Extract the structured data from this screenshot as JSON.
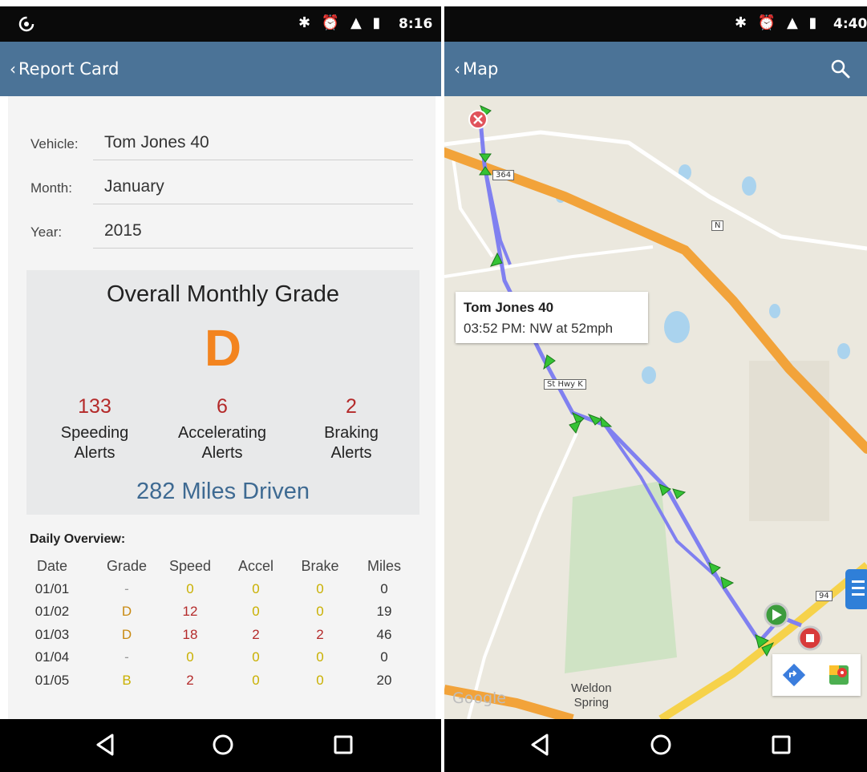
{
  "left_screen": {
    "status_bar": {
      "time": "8:16",
      "icons": [
        "app-notification-icon",
        "bluetooth-icon",
        "alarm-icon",
        "lte-signal-icon",
        "battery-icon"
      ]
    },
    "app_bar": {
      "back_label": "Report Card"
    },
    "form": {
      "vehicle_label": "Vehicle:",
      "vehicle_value": "Tom Jones  40",
      "month_label": "Month:",
      "month_value": "January",
      "year_label": "Year:",
      "year_value": "2015"
    },
    "overall": {
      "title": "Overall Monthly Grade",
      "grade": "D",
      "alerts": [
        {
          "count": "133",
          "label_line1": "Speeding",
          "label_line2": "Alerts"
        },
        {
          "count": "6",
          "label_line1": "Accelerating",
          "label_line2": "Alerts"
        },
        {
          "count": "2",
          "label_line1": "Braking",
          "label_line2": "Alerts"
        }
      ],
      "miles_driven": "282 Miles Driven"
    },
    "daily": {
      "title": "Daily Overview:",
      "headers": [
        "Date",
        "Grade",
        "Speed",
        "Accel",
        "Brake",
        "Miles"
      ],
      "rows": [
        [
          "01/01",
          "-",
          "0",
          "0",
          "0",
          "0"
        ],
        [
          "01/02",
          "D",
          "12",
          "0",
          "0",
          "19"
        ],
        [
          "01/03",
          "D",
          "18",
          "2",
          "2",
          "46"
        ],
        [
          "01/04",
          "-",
          "0",
          "0",
          "0",
          "0"
        ],
        [
          "01/05",
          "B",
          "2",
          "0",
          "0",
          "20"
        ]
      ]
    }
  },
  "right_screen": {
    "status_bar": {
      "time": "4:40",
      "icons": [
        "bluetooth-icon",
        "alarm-icon",
        "lte-signal-icon",
        "battery-icon"
      ]
    },
    "app_bar": {
      "back_label": "Map",
      "search_icon": "search-icon"
    },
    "tooltip": {
      "vehicle": "Tom Jones  40",
      "detail": "03:52 PM: NW at 52mph"
    },
    "map_labels": {
      "highway_364": "364",
      "route_n": "N",
      "st_hwy_k": "St Hwy K",
      "highway_94": "94",
      "town_line1": "Weldon",
      "town_line2": "Spring",
      "google": "Google"
    },
    "buttons": [
      "directions-icon",
      "google-maps-icon",
      "list-icon"
    ]
  },
  "nav_bar": {
    "icons": [
      "back-icon",
      "home-icon",
      "recents-icon"
    ]
  },
  "colors": {
    "app_bar": "#4b7397",
    "grade": "#f3841f",
    "alert_count": "#b42a2a",
    "miles": "#3e6a92",
    "route": "#8080f0",
    "trip_marker": "#2fbf2f"
  }
}
